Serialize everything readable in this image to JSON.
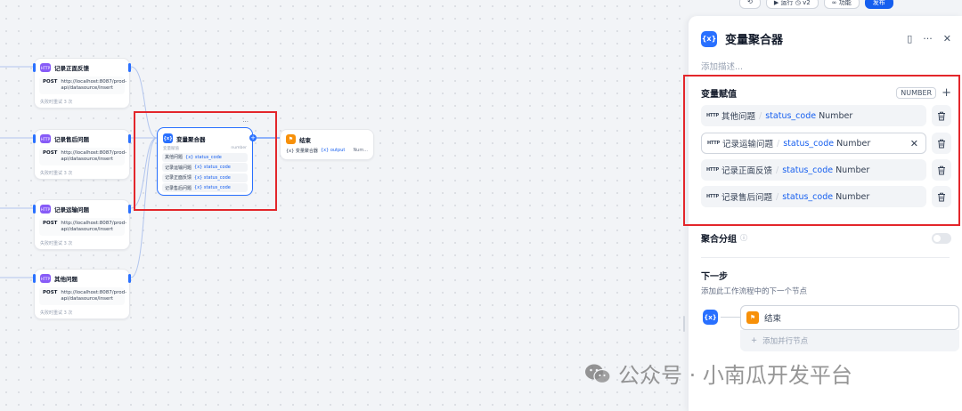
{
  "topbar": {
    "run_label": "运行",
    "version": "v2",
    "features_label": "功能",
    "publish_label": "发布"
  },
  "canvas": {
    "http_nodes": [
      {
        "title": "记录正面反馈",
        "method": "POST",
        "url_line1": "http://localhost:8087/prod-",
        "url_line2": "api/datasource/insert",
        "retry": "失败时重试 3 次"
      },
      {
        "title": "记录售后问题",
        "method": "POST",
        "url_line1": "http://localhost:8087/prod-",
        "url_line2": "api/datasource/insert",
        "retry": "失败时重试 3 次"
      },
      {
        "title": "记录运输问题",
        "method": "POST",
        "url_line1": "http://localhost:8087/prod-",
        "url_line2": "api/datasource/insert",
        "retry": "失败时重试 3 次"
      },
      {
        "title": "其他问题",
        "method": "POST",
        "url_line1": "http://localhost:8087/prod-",
        "url_line2": "api/datasource/insert",
        "retry": "失败时重试 3 次"
      }
    ],
    "http_badge": "HTTP",
    "aggregator": {
      "title": "变量聚合器",
      "icon_text": "{x}",
      "sub_label": "变量赋值",
      "type": "number",
      "rows": [
        {
          "source": "其他问题",
          "var": "{x} status_code"
        },
        {
          "source": "记录运输问题",
          "var": "{x} status_code"
        },
        {
          "source": "记录正面反馈",
          "var": "{x} status_code"
        },
        {
          "source": "记录售后问题",
          "var": "{x} status_code"
        }
      ]
    },
    "end_node": {
      "title": "结束",
      "output_source": "{x} 变量聚合器",
      "output_var": "{x} output",
      "output_type": "Num..."
    }
  },
  "panel": {
    "title": "变量聚合器",
    "icon_text": "{x}",
    "desc_placeholder": "添加描述...",
    "assign_title": "变量赋值",
    "assign_type": "NUMBER",
    "rows": [
      {
        "source": "其他问题",
        "var": "status_code",
        "type": "Number"
      },
      {
        "source": "记录运输问题",
        "var": "status_code",
        "type": "Number"
      },
      {
        "source": "记录正面反馈",
        "var": "status_code",
        "type": "Number"
      },
      {
        "source": "记录售后问题",
        "var": "status_code",
        "type": "Number"
      }
    ],
    "http_tag": "HTTP",
    "group_title": "聚合分组",
    "next_title": "下一步",
    "next_desc": "添加此工作流程中的下一个节点",
    "next_node": "结束",
    "add_parallel": "添加并行节点"
  },
  "watermark": {
    "text": "公众号 · 小南瓜开发平台"
  },
  "colors": {
    "accent": "#2970ff",
    "highlight_box": "#e3262b",
    "end_node": "#f79009",
    "http_badge": "#875bf7"
  }
}
